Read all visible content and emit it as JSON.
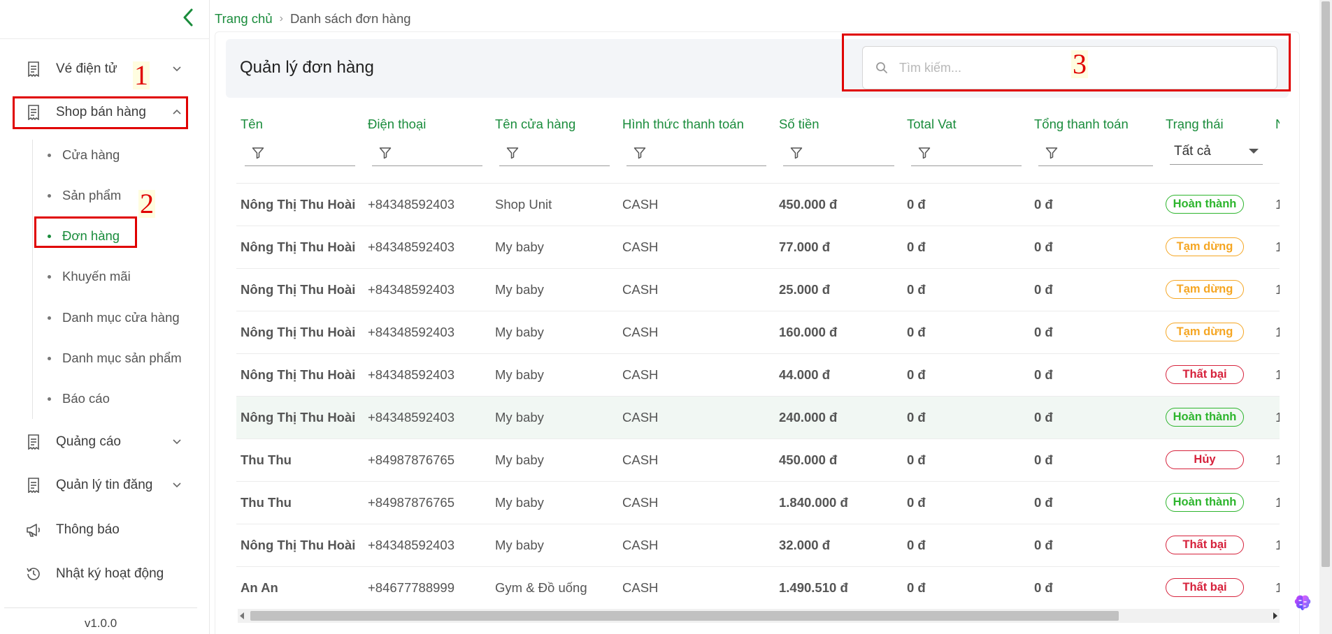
{
  "sidebar": {
    "collapse_icon": "chevron-left-icon",
    "menu": [
      {
        "label": "Vé điện tử",
        "icon": "receipt-icon",
        "chevron": "chevron-down-icon"
      },
      {
        "label": "Shop bán hàng",
        "icon": "receipt-icon",
        "chevron": "chevron-up-icon"
      },
      {
        "label": "Quảng cáo",
        "icon": "receipt-icon",
        "chevron": "chevron-down-icon"
      },
      {
        "label": "Quản lý tin đăng",
        "icon": "receipt-icon",
        "chevron": "chevron-down-icon"
      },
      {
        "label": "Thông báo",
        "icon": "megaphone-icon"
      },
      {
        "label": "Nhật ký hoạt động",
        "icon": "history-icon"
      }
    ],
    "submenu": [
      "Cửa hàng",
      "Sản phẩm",
      "Đơn hàng",
      "Khuyến mãi",
      "Danh mục cửa hàng",
      "Danh mục sản phẩm",
      "Báo cáo"
    ],
    "active_submenu": "Đơn hàng",
    "version": "v1.0.0"
  },
  "annotations": {
    "one": "1",
    "two": "2",
    "three": "3",
    "color": "#e00000"
  },
  "breadcrumb": {
    "home": "Trang chủ",
    "separator": "›",
    "current": "Danh sách đơn hàng"
  },
  "page": {
    "title": "Quản lý đơn hàng"
  },
  "search": {
    "placeholder": "Tìm kiếm...",
    "value": ""
  },
  "table": {
    "columns": [
      "Tên",
      "Điện thoại",
      "Tên cửa hàng",
      "Hình thức thanh toán",
      "Số tiền",
      "Total Vat",
      "Tổng thanh toán",
      "Trạng thái",
      "N"
    ],
    "status_filter": "Tất cả",
    "rows": [
      {
        "name": "Nông Thị Thu Hoài",
        "phone": "+84348592403",
        "store": "Shop Unit",
        "payment": "CASH",
        "amount": "450.000 đ",
        "vat": "0 đ",
        "total": "0 đ",
        "status": "Hoàn thành",
        "last": "1"
      },
      {
        "name": "Nông Thị Thu Hoài",
        "phone": "+84348592403",
        "store": "My baby",
        "payment": "CASH",
        "amount": "77.000 đ",
        "vat": "0 đ",
        "total": "0 đ",
        "status": "Tạm dừng",
        "last": "1"
      },
      {
        "name": "Nông Thị Thu Hoài",
        "phone": "+84348592403",
        "store": "My baby",
        "payment": "CASH",
        "amount": "25.000 đ",
        "vat": "0 đ",
        "total": "0 đ",
        "status": "Tạm dừng",
        "last": "1"
      },
      {
        "name": "Nông Thị Thu Hoài",
        "phone": "+84348592403",
        "store": "My baby",
        "payment": "CASH",
        "amount": "160.000 đ",
        "vat": "0 đ",
        "total": "0 đ",
        "status": "Tạm dừng",
        "last": "1"
      },
      {
        "name": "Nông Thị Thu Hoài",
        "phone": "+84348592403",
        "store": "My baby",
        "payment": "CASH",
        "amount": "44.000 đ",
        "vat": "0 đ",
        "total": "0 đ",
        "status": "Thất bại",
        "last": "1"
      },
      {
        "name": "Nông Thị Thu Hoài",
        "phone": "+84348592403",
        "store": "My baby",
        "payment": "CASH",
        "amount": "240.000 đ",
        "vat": "0 đ",
        "total": "0 đ",
        "status": "Hoàn thành",
        "last": "1",
        "highlighted": true
      },
      {
        "name": "Thu Thu",
        "phone": "+84987876765",
        "store": "My baby",
        "payment": "CASH",
        "amount": "450.000 đ",
        "vat": "0 đ",
        "total": "0 đ",
        "status": "Hủy",
        "last": "1"
      },
      {
        "name": "Thu Thu",
        "phone": "+84987876765",
        "store": "My baby",
        "payment": "CASH",
        "amount": "1.840.000 đ",
        "vat": "0 đ",
        "total": "0 đ",
        "status": "Hoàn thành",
        "last": "1"
      },
      {
        "name": "Nông Thị Thu Hoài",
        "phone": "+84348592403",
        "store": "My baby",
        "payment": "CASH",
        "amount": "32.000 đ",
        "vat": "0 đ",
        "total": "0 đ",
        "status": "Thất bại",
        "last": "1"
      },
      {
        "name": "An An",
        "phone": "+84677788999",
        "store": "Gym & Đồ uống",
        "payment": "CASH",
        "amount": "1.490.510 đ",
        "vat": "0 đ",
        "total": "0 đ",
        "status": "Thất bại",
        "last": "1"
      }
    ]
  },
  "status_colors": {
    "Hoàn thành": "#2db52d",
    "Tạm dừng": "#f5a623",
    "Thất bại": "#d6213b",
    "Hủy": "#d6213b"
  },
  "colors": {
    "accent": "#1a8c3c",
    "link": "#1e88e5"
  }
}
